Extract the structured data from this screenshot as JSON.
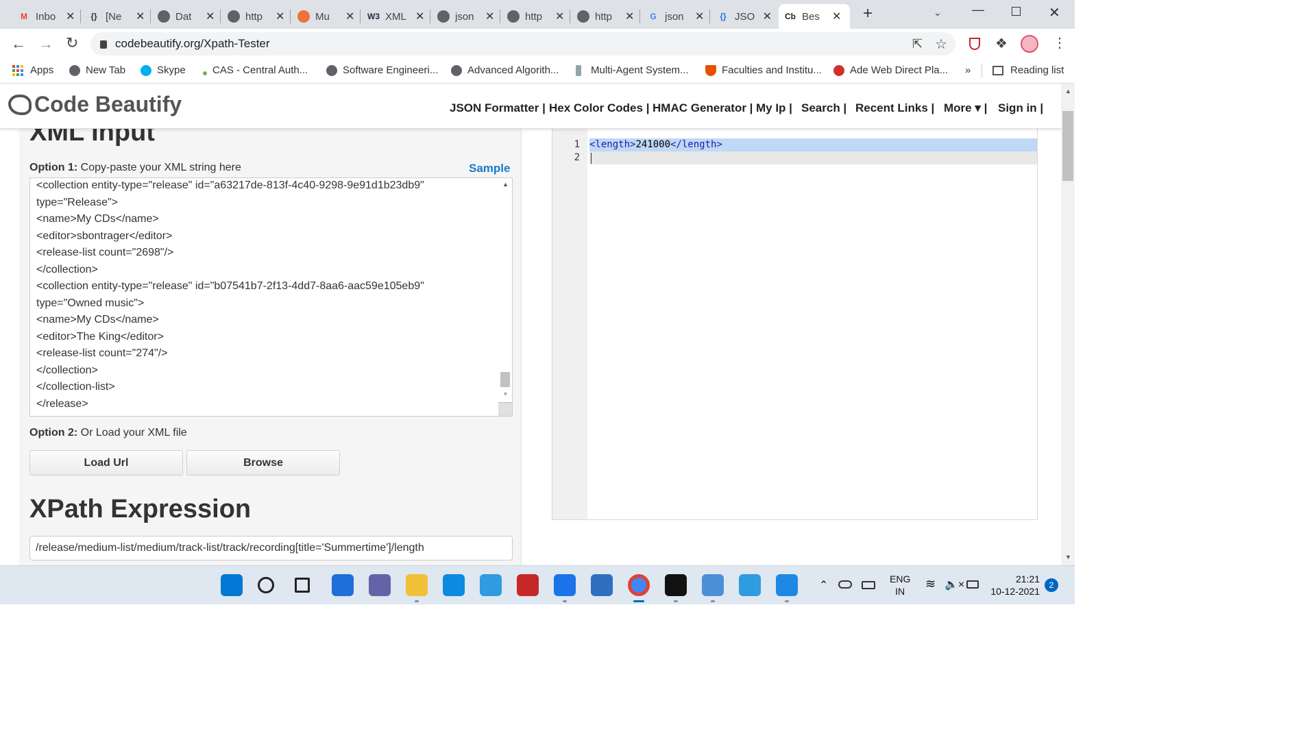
{
  "tabs": [
    {
      "label": "Inbo",
      "icon": "gmail-icon",
      "color": "#ea4335",
      "glyph": "M"
    },
    {
      "label": "[Ne",
      "icon": "braces-icon",
      "color": "#333333",
      "glyph": "{}"
    },
    {
      "label": "Dat",
      "icon": "globe-icon",
      "color": "#5f6368",
      "glyph": ""
    },
    {
      "label": "http",
      "icon": "globe-icon",
      "color": "#5f6368",
      "glyph": ""
    },
    {
      "label": "Mu",
      "icon": "musicbrainz-icon",
      "color": "#eb743b",
      "glyph": ""
    },
    {
      "label": "XML",
      "icon": "w3schools-icon",
      "color": "#282a35",
      "glyph": "W3"
    },
    {
      "label": "json",
      "icon": "globe-icon",
      "color": "#5f6368",
      "glyph": ""
    },
    {
      "label": "http",
      "icon": "globe-icon",
      "color": "#5f6368",
      "glyph": ""
    },
    {
      "label": "http",
      "icon": "globe-icon",
      "color": "#5f6368",
      "glyph": ""
    },
    {
      "label": "json",
      "icon": "google-icon",
      "color": "#4285f4",
      "glyph": "G"
    },
    {
      "label": "JSO",
      "icon": "json-icon",
      "color": "#1a73e8",
      "glyph": "{}"
    },
    {
      "label": "Bes",
      "icon": "codebeautify-icon",
      "color": "#222222",
      "glyph": "Cb"
    }
  ],
  "address": {
    "url": "codebeautify.org/Xpath-Tester"
  },
  "bookmarks": [
    {
      "label": "Apps",
      "icon": "apps-grid-icon"
    },
    {
      "label": "New Tab",
      "icon": "globe-icon"
    },
    {
      "label": "Skype",
      "icon": "skype-icon"
    },
    {
      "label": "CAS - Central Auth...",
      "icon": "cas-icon"
    },
    {
      "label": "Software Engineeri...",
      "icon": "globe-icon"
    },
    {
      "label": "Advanced Algorith...",
      "icon": "globe-icon"
    },
    {
      "label": "Multi-Agent System...",
      "icon": "robot-icon"
    },
    {
      "label": "Faculties and Institu...",
      "icon": "shield-icon"
    },
    {
      "label": "Ade Web Direct Pla...",
      "icon": "check-icon"
    }
  ],
  "bookmarks_more": "»",
  "reading_list": "Reading list",
  "site": {
    "logo": "Code Beautify",
    "nav": [
      "JSON Formatter |",
      "Hex Color Codes |",
      "HMAC Generator |",
      "My Ip |",
      "Search |",
      "Recent Links |",
      "More ▾ |",
      "Sign in |"
    ]
  },
  "left": {
    "heading": "XML Input",
    "option1_bold": "Option 1:",
    "option1_text": " Copy-paste your XML string here",
    "sample": "Sample",
    "xml_lines": [
      "<collection entity-type=\"release\" id=\"a63217de-813f-4c40-9298-9e91d1b23db9\"",
      "type=\"Release\">",
      "<name>My CDs</name>",
      "<editor>sbontrager</editor>",
      "<release-list count=\"2698\"/>",
      "</collection>",
      "<collection entity-type=\"release\" id=\"b07541b7-2f13-4dd7-8aa6-aac59e105eb9\"",
      "type=\"Owned music\">",
      "<name>My CDs</name>",
      "<editor>The King</editor>",
      "<release-list count=\"274\"/>",
      "</collection>",
      "</collection-list>",
      "</release>"
    ],
    "option2_bold": "Option 2:",
    "option2_text": " Or Load your XML file",
    "load_url": "Load Url",
    "browse": "Browse",
    "xpath_heading": "XPath Expression",
    "xpath_value": "/release/medium-list/medium/track-list/track/recording[title='Summertime']/length"
  },
  "output": {
    "line_numbers": [
      "1",
      "2"
    ],
    "open_tag": "<length>",
    "value": "241000",
    "close_tag": "</length>"
  },
  "taskbar": {
    "apps": [
      "windows-start-icon",
      "search-icon",
      "task-view-icon",
      "widgets-icon",
      "teams-chat-icon",
      "file-explorer-icon",
      "edge-icon",
      "l-app-icon",
      "mcafee-icon",
      "mail-icon",
      "store-icon",
      "chrome-icon",
      "pycharm-icon",
      "notepad-icon",
      "paint-icon",
      "photos-icon"
    ],
    "lang_line1": "ENG",
    "lang_line2": "IN",
    "time": "21:21",
    "date": "10-12-2021",
    "notification_count": "2"
  }
}
